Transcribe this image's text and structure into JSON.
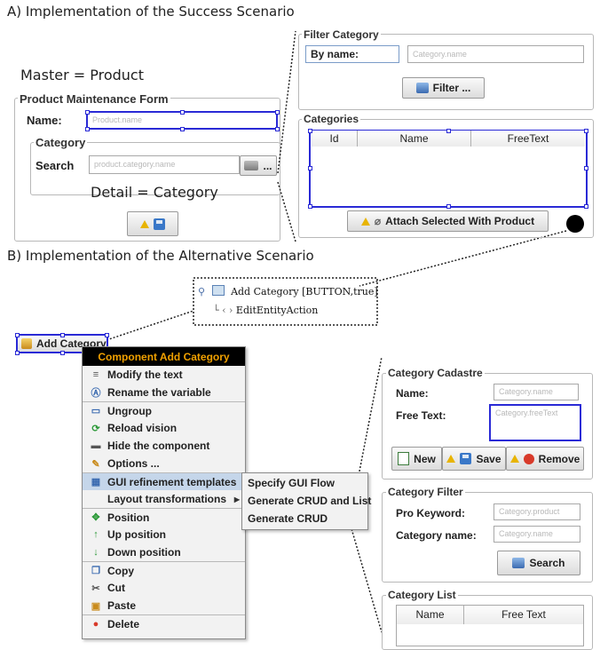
{
  "section_a": {
    "heading": "A) Implementation of the Success Scenario",
    "master_label": "Master = Product",
    "detail_label": "Detail = Category",
    "form": {
      "title": "Product Maintenance Form",
      "name_label": "Name:",
      "name_placeholder": "Product.name",
      "category_title": "Category",
      "search_label": "Search",
      "search_placeholder": "product.category.name",
      "browse_label": "..."
    },
    "filter": {
      "title": "Filter Category",
      "by_name_label": "By name:",
      "name_placeholder": "Category.name",
      "button_label": "Filter ..."
    },
    "categories": {
      "title": "Categories",
      "columns": [
        "Id",
        "Name",
        "FreeText"
      ],
      "attach_button": "Attach Selected With  Product"
    }
  },
  "section_b": {
    "heading": "B) Implementation of the Alternative Scenario",
    "selected_button": "Add Category",
    "tree": {
      "root": "Add Category [BUTTON,true]",
      "child": "EditEntityAction"
    },
    "context_menu": {
      "header": "Component Add Category",
      "items": [
        {
          "label": "Modify the text",
          "icon": "text-icon",
          "sep": false
        },
        {
          "label": "Rename the variable",
          "icon": "rename-icon",
          "sep": false
        },
        {
          "label": "Ungroup",
          "icon": "ungroup-icon",
          "sep": true
        },
        {
          "label": "Reload vision",
          "icon": "reload-icon",
          "sep": false
        },
        {
          "label": "Hide the component",
          "icon": "hide-icon",
          "sep": false
        },
        {
          "label": "Options ...",
          "icon": "options-icon",
          "sep": false
        },
        {
          "label": "GUI refinement templates",
          "icon": "templates-icon",
          "sep": true,
          "submenu": true,
          "active": true
        },
        {
          "label": "Layout transformations",
          "icon": "",
          "sep": false,
          "submenu": true
        },
        {
          "label": "Position",
          "icon": "position-icon",
          "sep": true
        },
        {
          "label": "Up position",
          "icon": "up-icon",
          "sep": false
        },
        {
          "label": "Down position",
          "icon": "down-icon",
          "sep": false
        },
        {
          "label": "Copy",
          "icon": "copy-icon",
          "sep": true
        },
        {
          "label": "Cut",
          "icon": "cut-icon",
          "sep": false
        },
        {
          "label": "Paste",
          "icon": "paste-icon",
          "sep": false
        },
        {
          "label": "Delete",
          "icon": "delete-icon",
          "sep": true
        }
      ],
      "submenu": [
        "Specify GUI Flow",
        "Generate CRUD and List",
        "Generate CRUD"
      ]
    },
    "cadastre": {
      "title": "Category Cadastre",
      "name_label": "Name:",
      "name_placeholder": "Category.name",
      "free_text_label": "Free Text:",
      "free_text_placeholder": "Category.freeText",
      "buttons": [
        "New",
        "Save",
        "Remove"
      ]
    },
    "category_filter": {
      "title": "Category Filter",
      "keyword_label": "Pro   Keyword:",
      "keyword_placeholder": "Category.product",
      "name_label": "Category name:",
      "name_placeholder": "Category.name",
      "search_button": "Search"
    },
    "category_list": {
      "title": "Category List",
      "columns": [
        "Name",
        "Free Text"
      ]
    }
  }
}
